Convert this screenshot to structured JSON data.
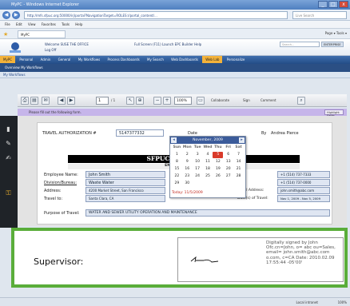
{
  "window": {
    "title": "MyPC - Windows Internet Explorer",
    "buttons": [
      "_",
      "□",
      "x"
    ]
  },
  "browser": {
    "address": "http://mfs.sfpuc.org:50000/irj/portal?NavigationTarget=ROLES://portal_content/...",
    "search_placeholder": "Live Search",
    "menu": [
      "File",
      "Edit",
      "View",
      "Favorites",
      "Tools",
      "Help"
    ],
    "tab_label": "MyPC",
    "tools": "Page ▾  Tools ▾"
  },
  "portal": {
    "welcome": "Welcome SUSE THE OFFICE",
    "logoff": "Log Off",
    "links": "Full Screen (F11)   Launch EPC Builder   Help",
    "search_placeholder": "Search...",
    "search_button": "ENTERPRISE",
    "nav_items": [
      {
        "label": "MyPC",
        "active": true
      },
      {
        "label": "Personal",
        "active": false
      },
      {
        "label": "Admin",
        "active": false
      },
      {
        "label": "General",
        "active": false
      },
      {
        "label": "My Workflows",
        "active": false
      },
      {
        "label": "Process Dashboards",
        "active": false
      },
      {
        "label": "My Search",
        "active": false
      },
      {
        "label": "Web Dashboards",
        "active": false
      },
      {
        "label": "Web Lab",
        "active": true
      },
      {
        "label": "Personalize",
        "active": false
      }
    ],
    "subnav": "Overview   My Workflows",
    "page_title": "My Workflows"
  },
  "pdf_toolbar": {
    "page_current": "1",
    "page_total": "/ 1",
    "zoom": "100%",
    "collaborate": "Collaborate",
    "sign": "Sign",
    "comment": "Comment"
  },
  "message_bar": {
    "text": "Please fill out the following form.",
    "highlight_button": "Highlight Fields"
  },
  "form": {
    "travel_auth_label": "TRAVEL AUTHORIZATION #",
    "travel_auth_value": "5147377332",
    "date_label": "Date",
    "by_label": "By",
    "by_value": "Andrea Pierce",
    "section_title": "SFPUC TRAVEL AUTH",
    "section_subtitle": "EMPLOYEE / TRAVE",
    "employee_name_label": "Employee Name:",
    "employee_name_value": "John Smith",
    "division_label": "Division/Bureau:",
    "division_value": "Waste Water",
    "address_label": "Address:",
    "address_value": "4200 Market Street, San Francisco",
    "travel_to_label": "Travel to:",
    "travel_to_value": "Santa Clara, CA",
    "phone_value": "+1 (514) 737-7333",
    "fax_value": "+1 (514) 737-0000",
    "email_label": "Email Address:",
    "email_value": "john.smith@abc.com",
    "dates_label": "Date(s) of Travel:",
    "dates_value": "Nov 1, 2009 - Nov 5, 2009",
    "purpose_label": "Purpose of Travel:",
    "purpose_value": "WATER AND SEWER UTILITY OPERATION AND MAINTENANCE"
  },
  "calendar": {
    "month": "November, 2009",
    "weekdays": [
      "Sun",
      "Mon",
      "Tue",
      "Wed",
      "Thu",
      "Fri",
      "Sat"
    ],
    "days": [
      "1",
      "2",
      "3",
      "4",
      "5",
      "6",
      "7",
      "8",
      "9",
      "10",
      "11",
      "12",
      "13",
      "14",
      "15",
      "16",
      "17",
      "18",
      "19",
      "20",
      "21",
      "22",
      "23",
      "24",
      "25",
      "26",
      "27",
      "28",
      "29",
      "30"
    ],
    "selected_day": "5",
    "today": "Today: 11/5/2009"
  },
  "signature": {
    "label": "Supervisor:",
    "details": "Digitally signed by John Ofc.cn=John, o= abc ou=Sales, email= john.smith@abc.com o.com, c=CA Date: 2010.02.09 17:55:44 -05'00'"
  },
  "status": {
    "zone": "Local intranet",
    "zoom": "100%"
  },
  "colors": {
    "highlight_frame": "#5aad3a",
    "message_bar": "#c6b5ea",
    "calendar_selected": "#d93a2a"
  }
}
